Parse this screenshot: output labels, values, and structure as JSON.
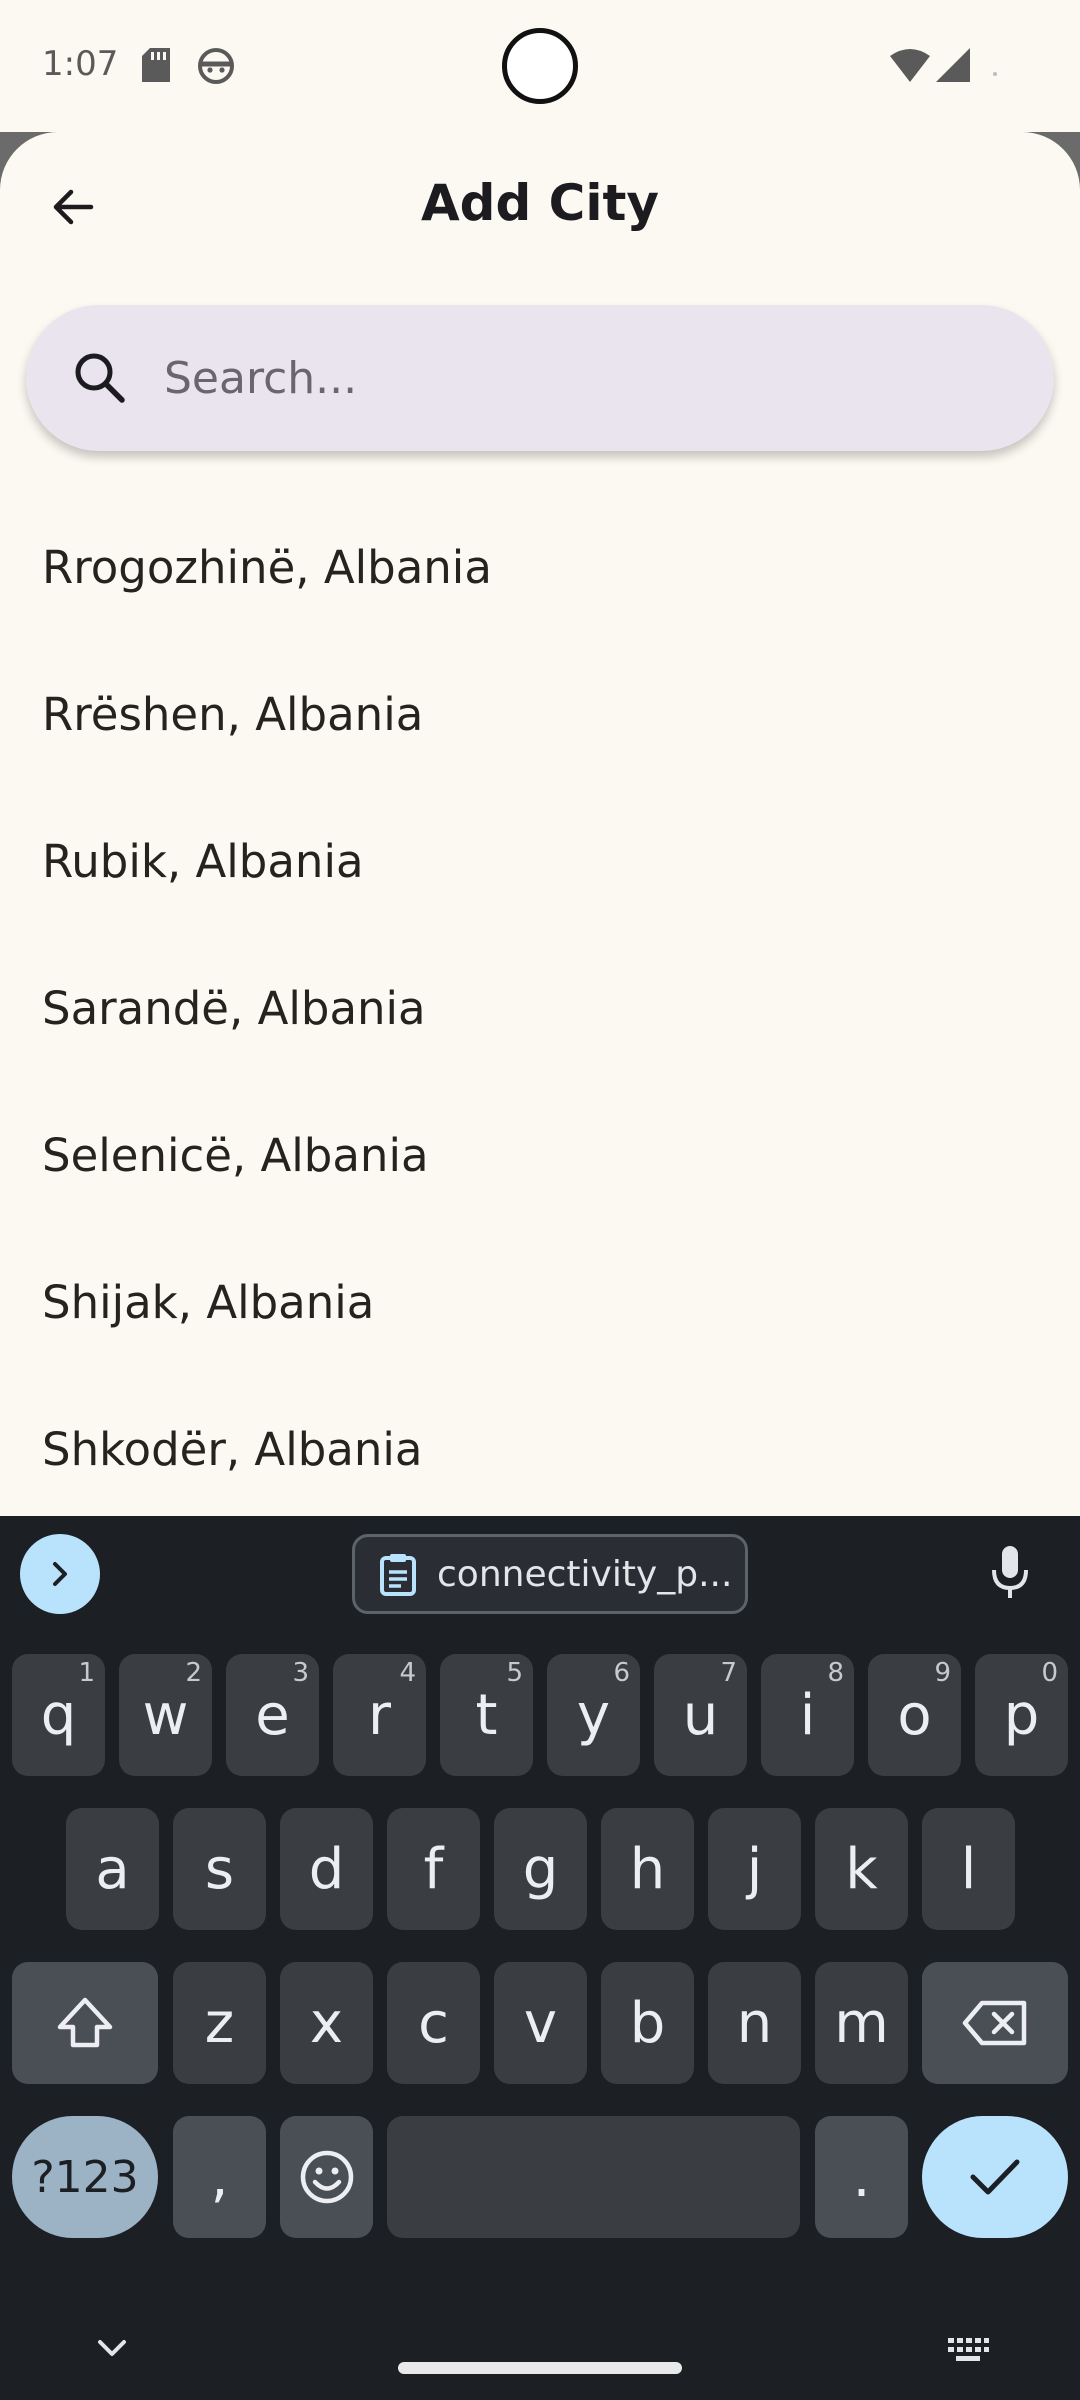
{
  "status_bar": {
    "time": "1:07"
  },
  "header": {
    "title": "Add City"
  },
  "search": {
    "placeholder": "Search...",
    "value": ""
  },
  "cities": [
    "Rrogozhinë, Albania",
    "Rrëshen, Albania",
    "Rubik, Albania",
    "Sarandë, Albania",
    "Selenicë, Albania",
    "Shijak, Albania",
    "Shkodër, Albania"
  ],
  "keyboard": {
    "clipboard_chip": "connectivity_p...",
    "row1": [
      {
        "key": "q",
        "hint": "1"
      },
      {
        "key": "w",
        "hint": "2"
      },
      {
        "key": "e",
        "hint": "3"
      },
      {
        "key": "r",
        "hint": "4"
      },
      {
        "key": "t",
        "hint": "5"
      },
      {
        "key": "y",
        "hint": "6"
      },
      {
        "key": "u",
        "hint": "7"
      },
      {
        "key": "i",
        "hint": "8"
      },
      {
        "key": "o",
        "hint": "9"
      },
      {
        "key": "p",
        "hint": "0"
      }
    ],
    "row2": [
      "a",
      "s",
      "d",
      "f",
      "g",
      "h",
      "j",
      "k",
      "l"
    ],
    "row3": [
      "z",
      "x",
      "c",
      "v",
      "b",
      "n",
      "m"
    ],
    "symbols_label": "?123",
    "comma": ",",
    "period": "."
  },
  "colors": {
    "background": "#fcf9f2",
    "search_fill": "#e9e4ee",
    "keyboard_bg": "#1c1f24",
    "key_bg": "#3a3d42",
    "accent_blue": "#b9e3fc"
  }
}
